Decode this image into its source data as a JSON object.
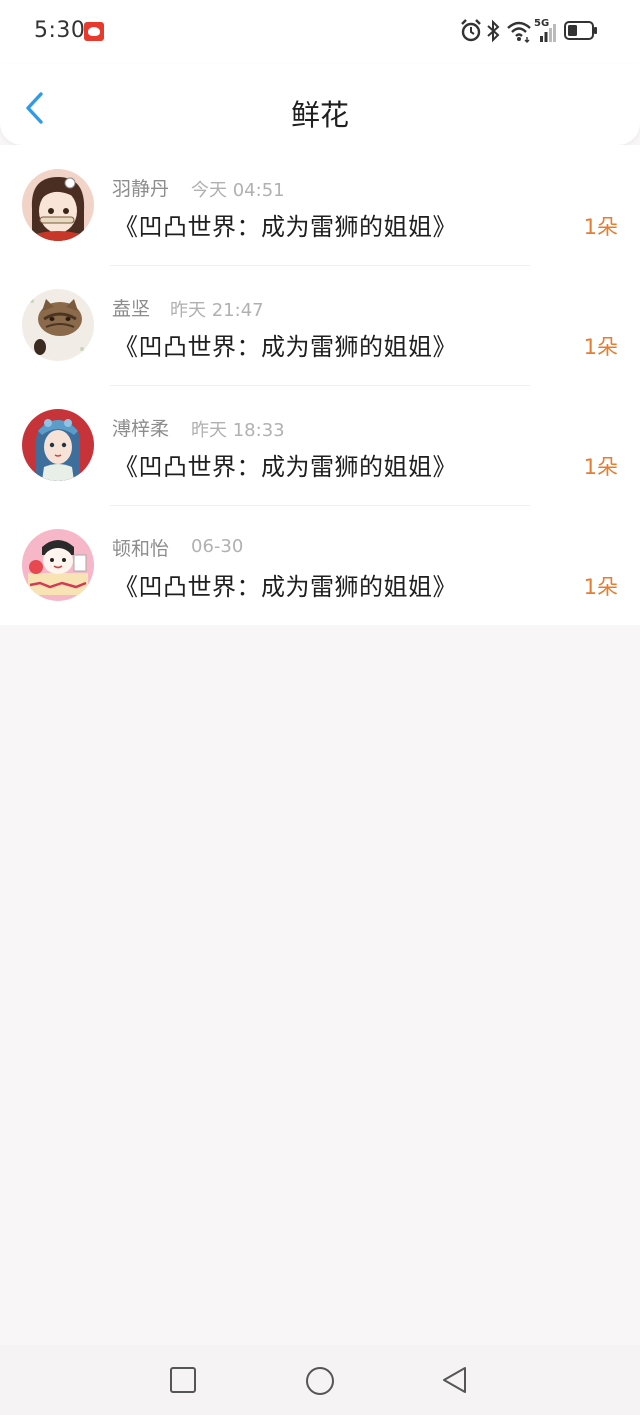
{
  "status_bar": {
    "time": "5:30",
    "network_label": "5G",
    "icons": [
      "app-notification-icon",
      "alarm-icon",
      "bluetooth-icon",
      "wifi-icon",
      "signal-icon",
      "battery-icon"
    ]
  },
  "header": {
    "title": "鲜花",
    "back_icon": "chevron-left-icon"
  },
  "colors": {
    "accent_blue": "#2d9be6",
    "flower_orange": "#e77b2e",
    "name_gray": "#8d8d8d",
    "time_gray": "#b1b1b1"
  },
  "records": [
    {
      "name": "羽静丹",
      "time": "今天 04:51",
      "book": "《凹凸世界：成为雷狮的姐姐》",
      "count": "1朵",
      "avatar": "avatar-girl-hairpin"
    },
    {
      "name": "盍坚",
      "time": "昨天 21:47",
      "book": "《凹凸世界：成为雷狮的姐姐》",
      "count": "1朵",
      "avatar": "avatar-cat"
    },
    {
      "name": "溥梓柔",
      "time": "昨天 18:33",
      "book": "《凹凸世界：成为雷狮的姐姐》",
      "count": "1朵",
      "avatar": "avatar-opera-girl"
    },
    {
      "name": "顿和怡",
      "time": "06-30",
      "book": "《凹凸世界：成为雷狮的姐姐》",
      "count": "1朵",
      "avatar": "avatar-cartoon-pink"
    }
  ],
  "nav_bar": {
    "buttons": [
      "recents-square-icon",
      "home-circle-icon",
      "back-triangle-icon"
    ]
  }
}
